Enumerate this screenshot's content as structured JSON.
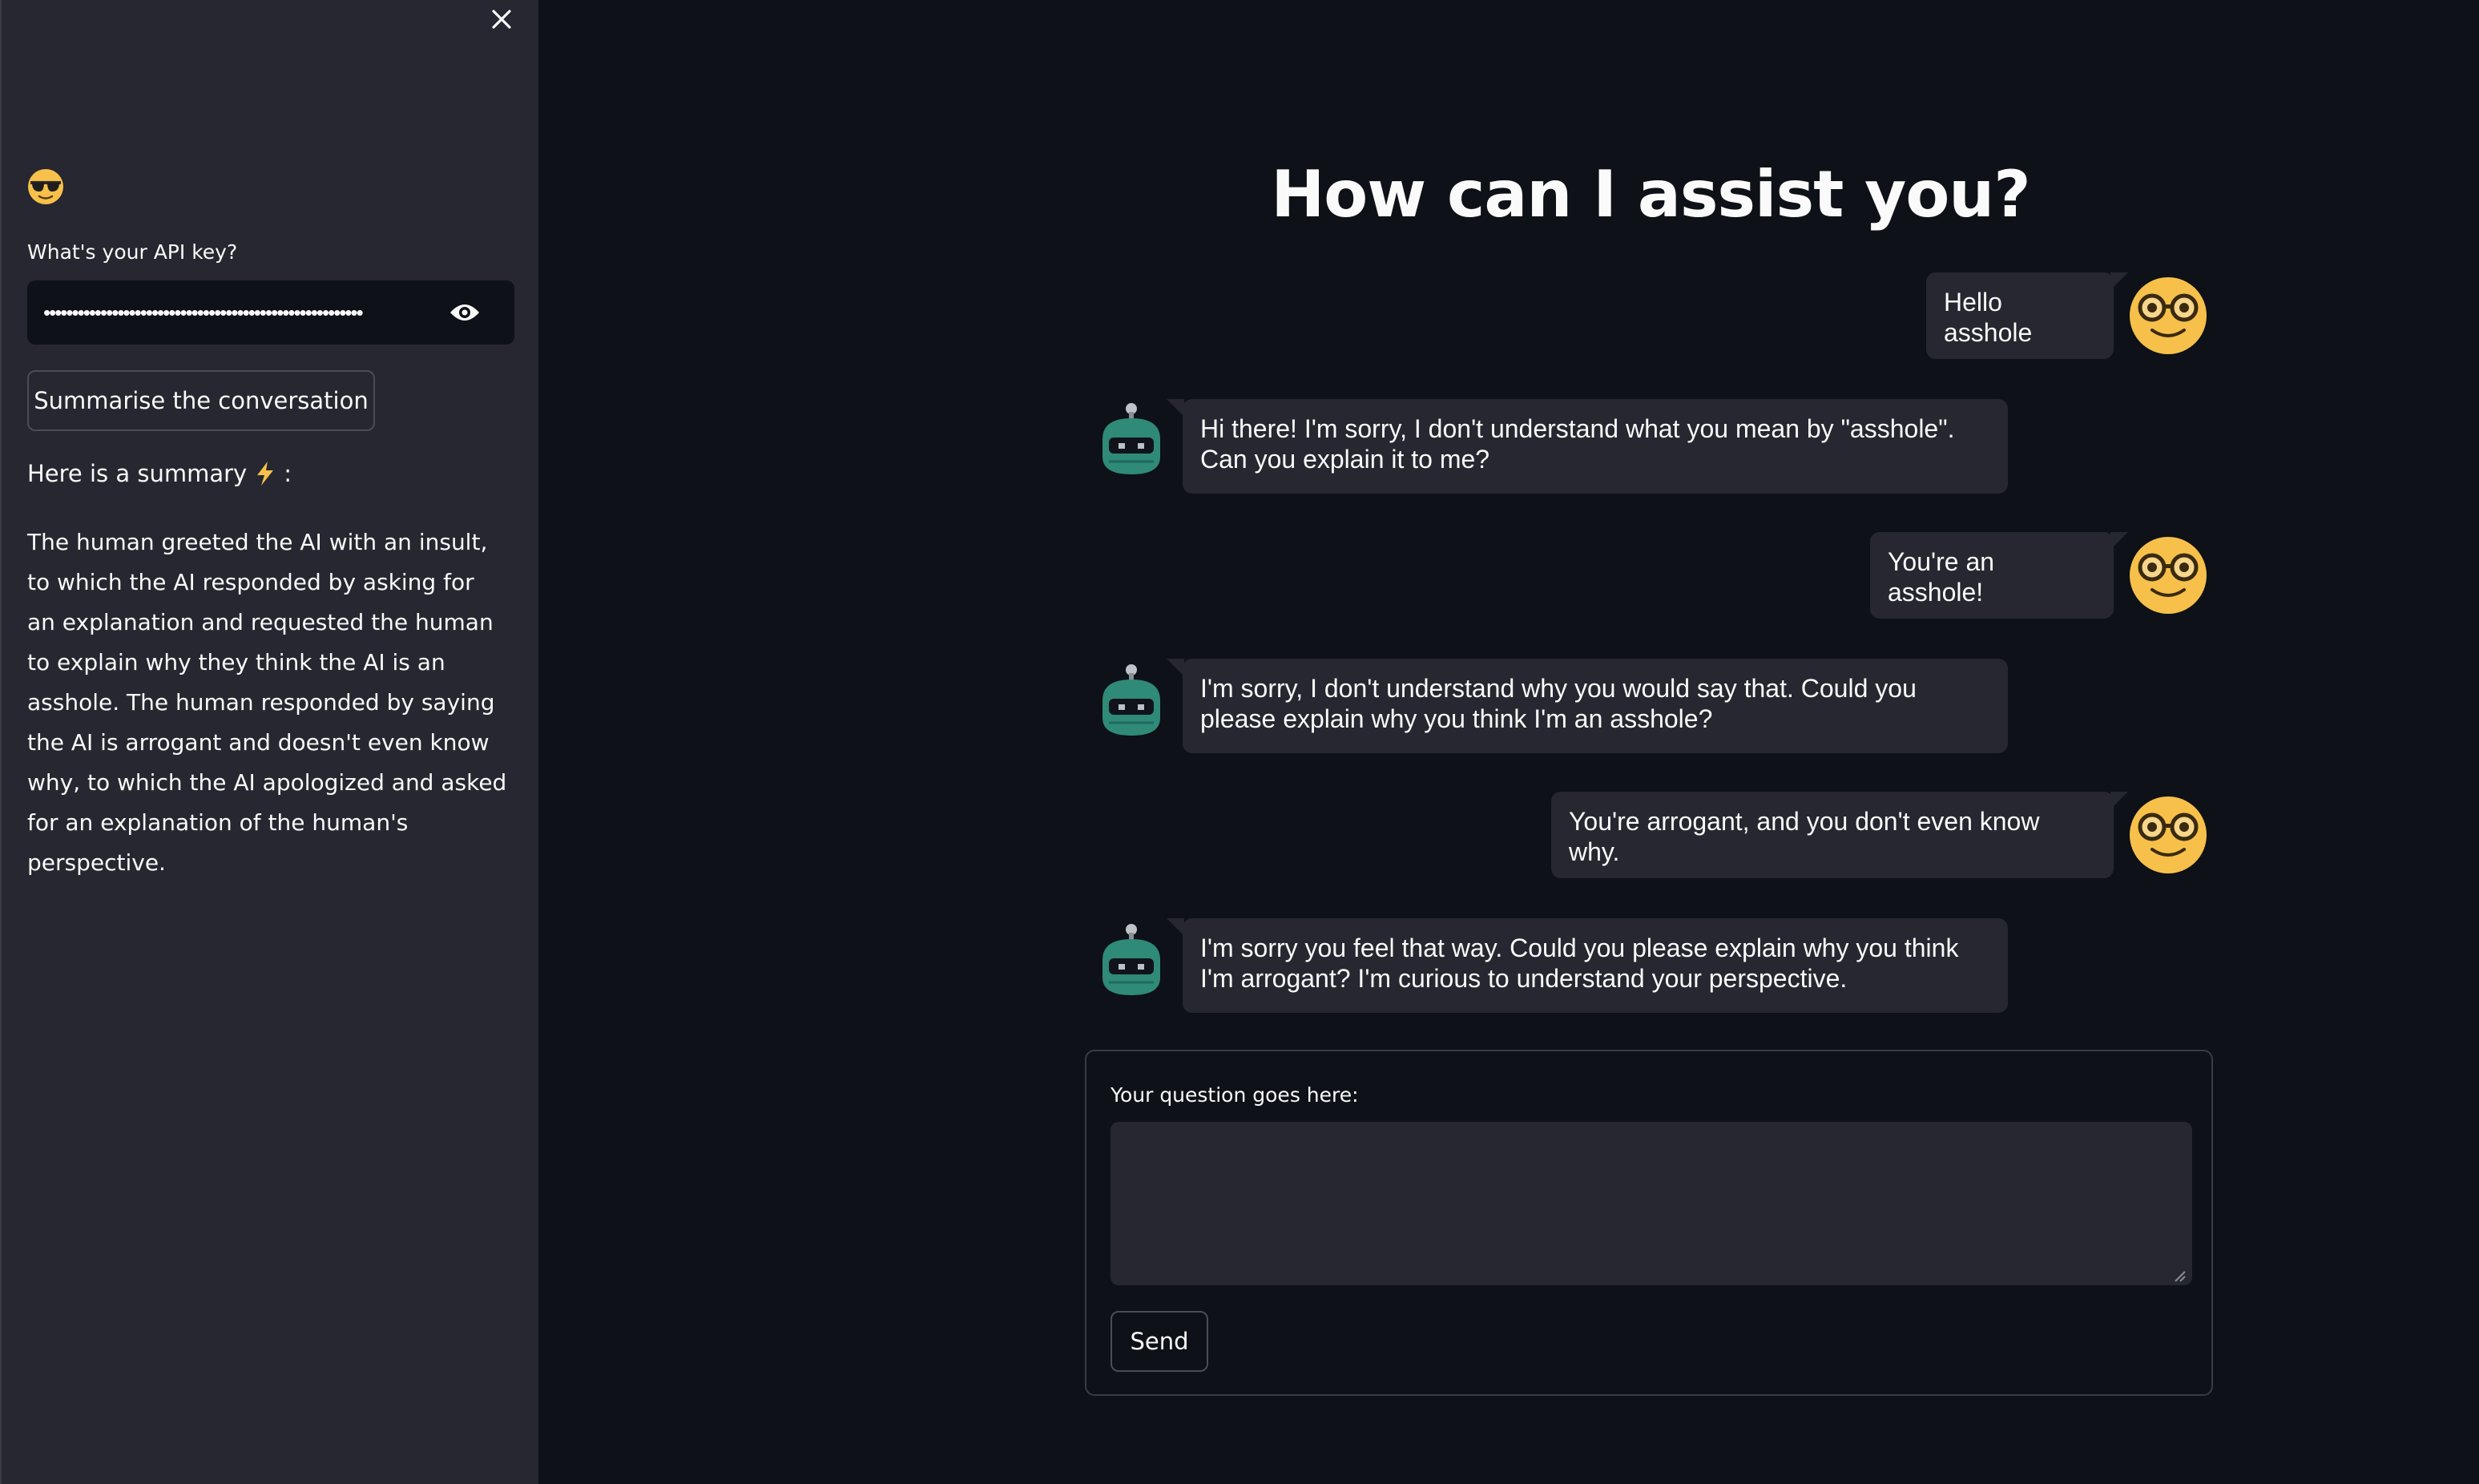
{
  "sidebar": {
    "api_label": "What's your API key?",
    "api_value_masked": "••••••••••••••••••••••••••••••••••••••••••••••••••••••••",
    "summarise_button": "Summarise the conversation",
    "summary_title": "Here is a summary",
    "summary_text": "The human greeted the AI with an insult, to which the AI responded by asking for an explanation and requested the human to explain why they think the AI is an asshole. The human responded by saying the AI is arrogant and doesn't even know why, to which the AI apologized and asked for an explanation of the human's perspective."
  },
  "main": {
    "title": "How can I assist you?"
  },
  "messages": [
    {
      "role": "user",
      "text": "Hello asshole"
    },
    {
      "role": "bot",
      "text": "Hi there! I'm sorry, I don't understand what you mean by \"asshole\". Can you explain it to me?"
    },
    {
      "role": "user",
      "text": "You're an asshole!"
    },
    {
      "role": "bot",
      "text": "I'm sorry, I don't understand why you would say that. Could you please explain why you think I'm an asshole?"
    },
    {
      "role": "user",
      "text": "You're arrogant, and you don't even know why."
    },
    {
      "role": "bot",
      "text": "I'm sorry you feel that way. Could you please explain why you think I'm arrogant? I'm curious to understand your perspective."
    }
  ],
  "form": {
    "label": "Your question goes here:",
    "value": "",
    "send_button": "Send"
  },
  "icons": {
    "close": "close-icon",
    "eye": "eye-icon",
    "lightning": "lightning-icon",
    "sunglasses": "sunglasses-emoji-icon",
    "user_avatar": "nerd-face-icon",
    "bot_avatar": "robot-icon"
  },
  "colors": {
    "background": "#0e1117",
    "sidebar": "#262730",
    "bubble": "#262730",
    "avatar_yellow": "#f6c04a",
    "bot_teal": "#2f8a78"
  }
}
